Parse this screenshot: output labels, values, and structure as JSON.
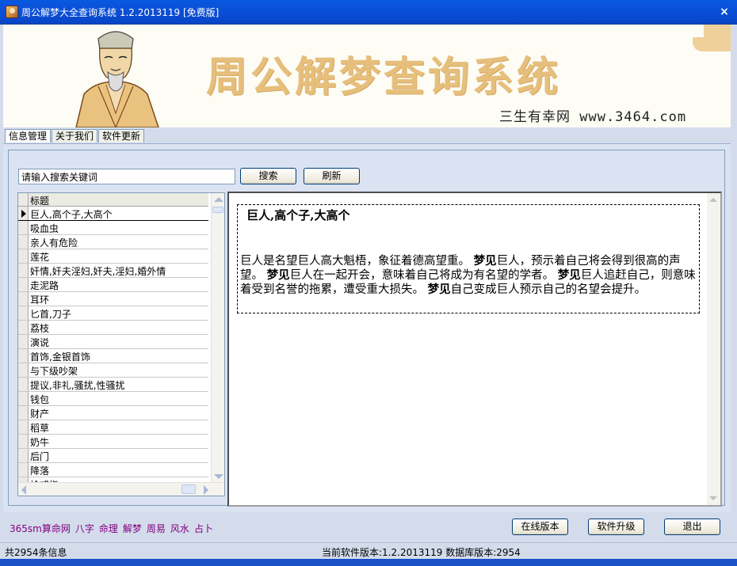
{
  "window": {
    "title": "周公解梦大全查询系统 1.2.2013119 [免费版]",
    "close_label": "×"
  },
  "banner": {
    "title": "周公解梦查询系统",
    "site": "三生有幸网 www.3464.com"
  },
  "tabs": [
    {
      "label": "信息管理"
    },
    {
      "label": "关于我们"
    },
    {
      "label": "软件更新"
    }
  ],
  "search": {
    "value": "请输入搜索关键词",
    "search_label": "搜索",
    "refresh_label": "刷新"
  },
  "list": {
    "header": "标题",
    "selected_index": 0,
    "items": [
      "巨人,高个子,大高个",
      "吸血虫",
      "亲人有危险",
      "莲花",
      "奸情,奸夫淫妇,奸夫,淫妇,婚外情",
      "走泥路",
      "耳环",
      "匕首,刀子",
      "荔枝",
      "演说",
      "首饰,金银首饰",
      "与下级吵架",
      "提议,非礼,骚扰,性骚扰",
      "钱包",
      "财产",
      "稻草",
      "奶牛",
      "后门",
      "降落",
      "捡戒指"
    ]
  },
  "detail": {
    "title": "巨人,高个子,大高个",
    "segments": [
      {
        "text": "巨人是名望巨人高大魁梧，象征着德高望重。 ",
        "bold": false
      },
      {
        "text": "梦见",
        "bold": true
      },
      {
        "text": "巨人，预示着自己将会得到很高的声望。 ",
        "bold": false
      },
      {
        "text": "梦见",
        "bold": true
      },
      {
        "text": "巨人在一起开会，意味着自己将成为有名望的学者。 ",
        "bold": false
      },
      {
        "text": "梦见",
        "bold": true
      },
      {
        "text": "巨人追赶自己，则意味着受到名誉的拖累，遭受重大损失。 ",
        "bold": false
      },
      {
        "text": "梦见",
        "bold": true
      },
      {
        "text": "自己变成巨人预示自己的名望会提升。",
        "bold": false
      }
    ]
  },
  "links": [
    "365sm算命网",
    "八字",
    "命理",
    "解梦",
    "周易",
    "风水",
    "占卜"
  ],
  "buttons": {
    "online": "在线版本",
    "upgrade": "软件升级",
    "exit": "退出"
  },
  "status": {
    "count": "共2954条信息",
    "version": "当前软件版本:1.2.2013119 数据库版本:2954"
  }
}
